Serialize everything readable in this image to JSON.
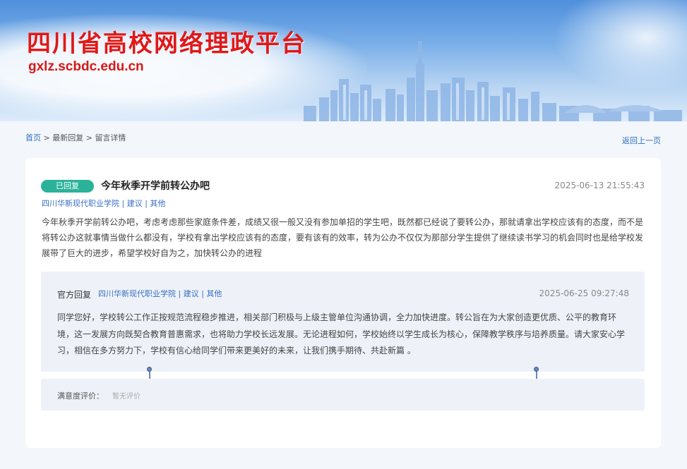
{
  "header": {
    "title": "四川省高校网络理政平台",
    "domain": "gxlz.scbdc.edu.cn"
  },
  "breadcrumb": {
    "home": "首页",
    "separator": " > ",
    "latest": "最新回复",
    "current": "留言详情"
  },
  "back_link": "返回上一页",
  "message": {
    "status_badge": "已回复",
    "title": "今年秋季开学前转公办吧",
    "time": "2025-06-13 21:55:43",
    "meta": "四川华新现代职业学院 | 建议 | 其他",
    "body": "今年秋季开学前转公办吧，考虑考虑那些家庭条件差，成绩又很一般又没有参加单招的学生吧，既然都已经说了要转公办，那就请拿出学校应该有的态度，而不是将转公办这就事情当做什么都没有，学校有拿出学校应该有的态度，要有该有的效率，转为公办不仅仅为那部分学生提供了继续读书学习的机会同时也是给学校发展带了巨大的进步，希望学校好自为之，加快转公办的进程"
  },
  "reply": {
    "label": "官方回复",
    "meta": "四川华新现代职业学院 | 建议 | 其他",
    "time": "2025-06-25 09:27:48",
    "body": "同学您好，学校转公工作正按规范流程稳步推进，相关部门积极与上级主管单位沟通协调，全力加快进度。转公旨在为大家创造更优质、公平的教育环境，这一发展方向既契合教育普惠需求，也将助力学校长远发展。无论进程如何，学校始终以学生成长为核心，保障教学秩序与培养质量。请大家安心学习，相信在多方努力下，学校有信心给同学们带来更美好的未来，让我们携手期待、共赴新篇 。"
  },
  "rating": {
    "label": "满意度评价：",
    "value": "暂无评价"
  },
  "colors": {
    "title_red": "#e01818",
    "badge_green": "#2bb39a",
    "link_blue": "#2f6fc0",
    "panel_bg": "#eef2f8",
    "page_bg": "#f3f6fa"
  }
}
